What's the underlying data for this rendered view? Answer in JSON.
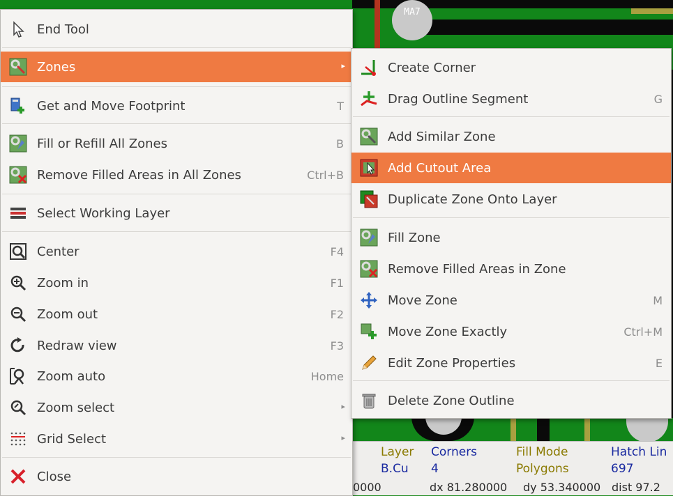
{
  "pcb": {
    "pad_label": "MA7"
  },
  "main_menu": {
    "items": [
      {
        "label": "End Tool",
        "shortcut": "",
        "icon": "cursor-arrow-icon"
      },
      {
        "label": "Zones",
        "shortcut": "",
        "icon": "zone-icon",
        "submenu": true,
        "highlighted": true
      },
      {
        "label": "Get and Move Footprint",
        "shortcut": "T",
        "icon": "footprint-move-icon"
      },
      {
        "label": "Fill or Refill All Zones",
        "shortcut": "B",
        "icon": "fill-zones-icon"
      },
      {
        "label": "Remove Filled Areas in All Zones",
        "shortcut": "Ctrl+B",
        "icon": "unfill-zones-icon"
      },
      {
        "label": "Select Working Layer",
        "shortcut": "",
        "icon": "layers-icon"
      },
      {
        "label": "Center",
        "shortcut": "F4",
        "icon": "center-icon"
      },
      {
        "label": "Zoom in",
        "shortcut": "F1",
        "icon": "zoom-in-icon"
      },
      {
        "label": "Zoom out",
        "shortcut": "F2",
        "icon": "zoom-out-icon"
      },
      {
        "label": "Redraw view",
        "shortcut": "F3",
        "icon": "redraw-icon"
      },
      {
        "label": "Zoom auto",
        "shortcut": "Home",
        "icon": "zoom-auto-icon"
      },
      {
        "label": "Zoom select",
        "shortcut": "",
        "icon": "zoom-select-icon",
        "submenu": true
      },
      {
        "label": "Grid Select",
        "shortcut": "",
        "icon": "grid-icon",
        "submenu": true
      },
      {
        "label": "Close",
        "shortcut": "",
        "icon": "close-icon"
      }
    ]
  },
  "sub_menu": {
    "items": [
      {
        "label": "Create Corner",
        "shortcut": "",
        "icon": "create-corner-icon"
      },
      {
        "label": "Drag Outline Segment",
        "shortcut": "G",
        "icon": "drag-segment-icon"
      },
      {
        "label": "Add Similar Zone",
        "shortcut": "",
        "icon": "similar-zone-icon"
      },
      {
        "label": "Add Cutout Area",
        "shortcut": "",
        "icon": "cutout-area-icon",
        "highlighted": true
      },
      {
        "label": "Duplicate Zone Onto Layer",
        "shortcut": "",
        "icon": "duplicate-zone-icon"
      },
      {
        "label": "Fill Zone",
        "shortcut": "",
        "icon": "fill-zone-icon"
      },
      {
        "label": "Remove Filled Areas in Zone",
        "shortcut": "",
        "icon": "unfill-zone-icon"
      },
      {
        "label": "Move Zone",
        "shortcut": "M",
        "icon": "move-icon"
      },
      {
        "label": "Move Zone Exactly",
        "shortcut": "Ctrl+M",
        "icon": "move-exact-icon"
      },
      {
        "label": "Edit Zone Properties",
        "shortcut": "E",
        "icon": "pencil-icon"
      },
      {
        "label": "Delete Zone Outline",
        "shortcut": "",
        "icon": "trash-icon"
      }
    ]
  },
  "status": {
    "layer_label": "Layer",
    "layer_value": "B.Cu",
    "corners_label": "Corners",
    "corners_value": "4",
    "fill_mode_label": "Fill Mode",
    "fill_mode_value": "Polygons",
    "hatch_label": "Hatch Lin",
    "hatch_value": "697",
    "coord_prefix": "0000",
    "dx": "dx 81.280000",
    "dy": "dy 53.340000",
    "dist": "dist 97.2"
  },
  "colors": {
    "highlight": "#ef7a42",
    "menu_bg": "#f5f4f2",
    "pcb_green": "#12861a"
  }
}
